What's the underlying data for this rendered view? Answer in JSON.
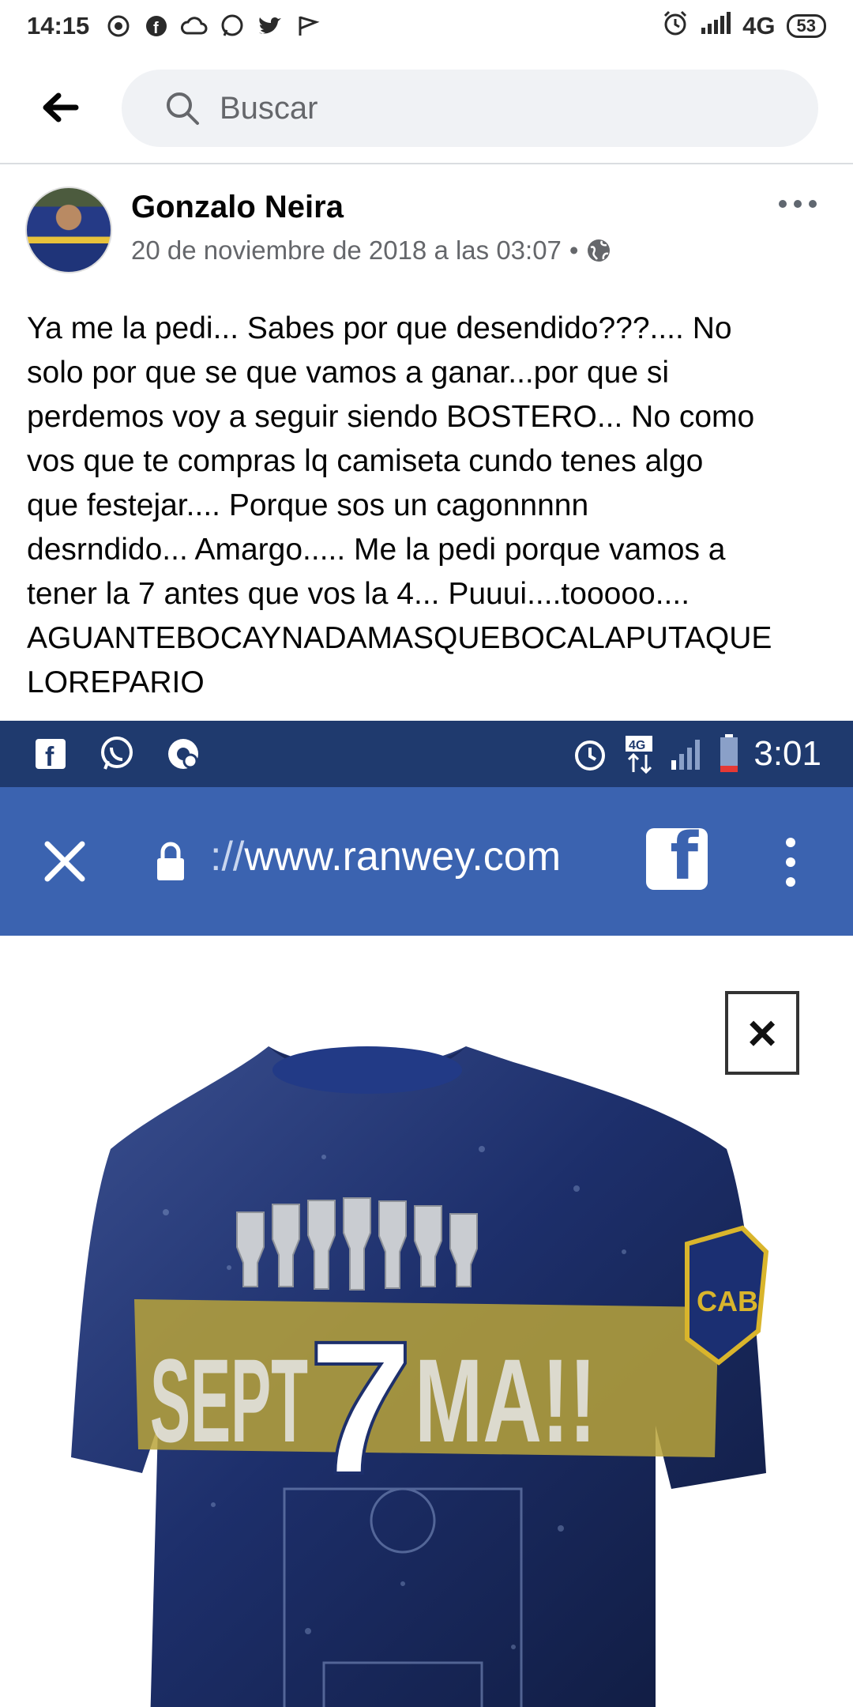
{
  "status_bar": {
    "time": "14:15",
    "network": "4G",
    "battery": "53"
  },
  "search": {
    "placeholder": "Buscar"
  },
  "post": {
    "author": "Gonzalo Neira",
    "timestamp": "20 de noviembre de 2018 a las 03:07",
    "separator": "•",
    "text_lines": [
      "Ya me la pedi... Sabes por que desendido???.... No",
      "solo por que se que vamos a ganar...por que si",
      "perdemos voy a seguir siendo BOSTERO... No como",
      "vos que te compras lq camiseta cundo tenes algo",
      "que festejar.... Porque sos un cagonnnnn",
      "desrndido... Amargo..... Me la pedi porque vamos a",
      "tener la 7 antes que vos la 4... Puuui....tooooo....",
      "AGUANTEBOCAYNADAMASQUEBOCALAPUTAQUE",
      "LOREPARIO"
    ]
  },
  "embedded_screenshot": {
    "time": "3:01",
    "network": "4G",
    "url_prefix": "://",
    "url_domain": "www.ranwey.com",
    "close_glyph": "×",
    "jersey_text_left": "SEPT",
    "jersey_text_seven": "7",
    "jersey_text_right": "MA!!",
    "badge_text": "CAB"
  },
  "colors": {
    "fb_blue": "#3b63b0",
    "status_dark": "#1f3a6e",
    "search_bg": "#f0f2f5",
    "meta_gray": "#65676b"
  }
}
